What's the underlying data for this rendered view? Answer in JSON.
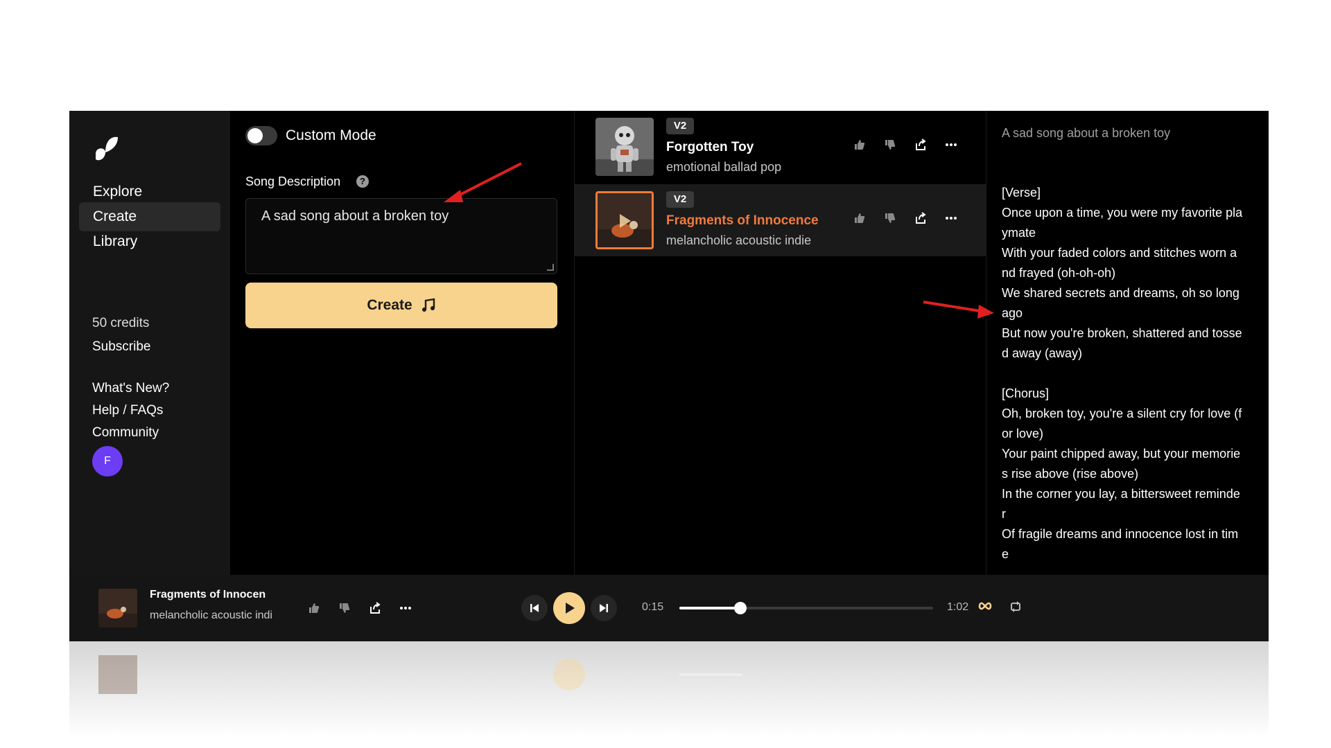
{
  "sidebar": {
    "nav": [
      {
        "label": "Explore"
      },
      {
        "label": "Create",
        "active": true
      },
      {
        "label": "Library"
      }
    ],
    "credits": "50 credits",
    "subscribe": "Subscribe",
    "links": [
      "What's New?",
      "Help / FAQs",
      "Community"
    ],
    "avatar_initial": "F",
    "logo_icon": "suno-wave-logo-icon"
  },
  "create": {
    "custom_mode_label": "Custom Mode",
    "custom_mode_on": false,
    "song_description_label": "Song Description",
    "song_description_value": "A sad song about a broken toy",
    "create_button_label": "Create",
    "accent_color": "#f8d38d"
  },
  "songs": [
    {
      "version": "V2",
      "title": "Forgotten Toy",
      "style": "emotional ballad pop",
      "selected": false
    },
    {
      "version": "V2",
      "title": "Fragments of Innocence",
      "style": "melancholic acoustic indie",
      "selected": true,
      "title_color": "#f07b3c"
    }
  ],
  "lyrics": {
    "prompt": "A sad song about a broken toy",
    "body": "[Verse]\nOnce upon a time, you were my favorite pla\nymate\nWith your faded colors and stitches worn a\nnd frayed (oh-oh-oh)\nWe shared secrets and dreams, oh so long\nago\nBut now you're broken, shattered and tosse\nd away (away)\n\n[Chorus]\nOh, broken toy, you're a silent cry for love (f\nor love)\nYour paint chipped away, but your memorie\ns rise above (rise above)\nIn the corner you lay, a bittersweet reminde\nr\nOf fragile dreams and innocence lost in tim\ne"
  },
  "player": {
    "title": "Fragments of Innocen",
    "style": "melancholic acoustic indi",
    "current_time": "0:15",
    "total_time": "1:02",
    "progress_fraction": 0.24
  }
}
